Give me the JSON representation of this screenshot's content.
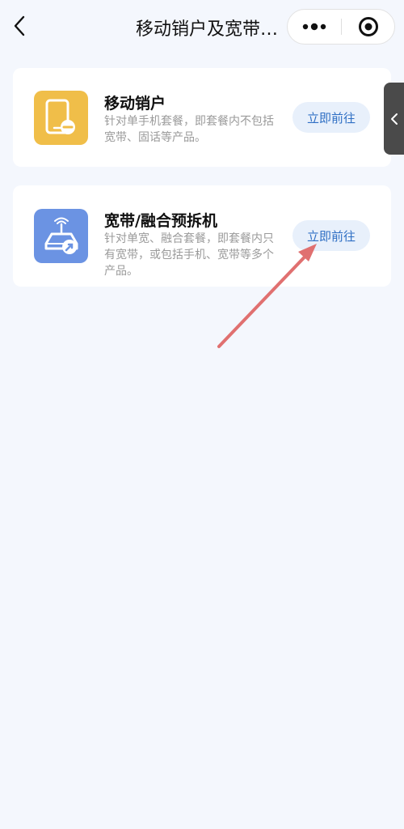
{
  "header": {
    "title": "移动销户及宽带/融合预拆机",
    "back_icon": "chevron-left-icon",
    "more_icon": "more-dots-icon",
    "close_icon": "target-circle-icon"
  },
  "cards": [
    {
      "title": "移动销户",
      "description": "针对单手机套餐，即套餐内不包括宽带、固话等产品。",
      "button_label": "立即前往",
      "icon": "phone-minus-icon",
      "icon_color": "#f0be49"
    },
    {
      "title": "宽带/融合预拆机",
      "description": "针对单宽、融合套餐，即套餐内只有宽带，或包括手机、宽带等多个产品。",
      "button_label": "立即前往",
      "icon": "router-wrench-icon",
      "icon_color": "#6b93e3"
    }
  ],
  "side_tab": {
    "icon": "chevron-left-icon"
  },
  "annotation": {
    "type": "arrow",
    "color": "#e07070"
  },
  "colors": {
    "background": "#f4f7fd",
    "button_bg": "#e8f0fb",
    "button_text": "#2f6fc4",
    "desc_text": "#9a9a9a"
  }
}
